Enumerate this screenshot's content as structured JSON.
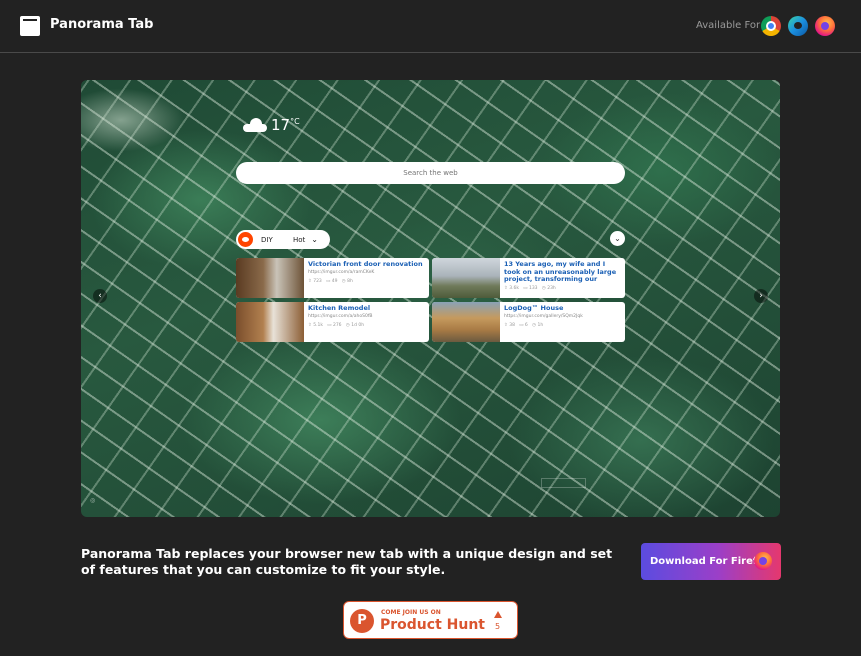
{
  "header": {
    "brand": "Panorama Tab",
    "available_label": "Available For",
    "browser_icons": [
      "chrome-icon",
      "edge-icon",
      "firefox-icon"
    ]
  },
  "preview": {
    "weather": {
      "temperature": "17",
      "unit": "°C",
      "icon": "cloud-icon"
    },
    "search_placeholder": "Search the web",
    "reddit": {
      "subreddit": "DIY",
      "sort": "Hot"
    },
    "posts": [
      {
        "title": "Victorian front door renovation",
        "link": "https://imgur.com/a/ramCKeK",
        "upvotes": "723",
        "comments": "49",
        "age": "8h"
      },
      {
        "title": "13 Years ago, my wife and I took on an unreasonably large project, transforming our",
        "link": "",
        "upvotes": "3.6k",
        "comments": "133",
        "age": "23h"
      },
      {
        "title": "Kitchen Remodel",
        "link": "https://imgur.com/a/ahoS0fB",
        "upvotes": "5.1k",
        "comments": "276",
        "age": "1d 0h"
      },
      {
        "title": "LogDog™ House",
        "link": "https://imgur.com/gallery/SQm2Jqk",
        "upvotes": "38",
        "comments": "6",
        "age": "1h"
      }
    ]
  },
  "tagline": "Panorama Tab replaces your browser new tab with a unique design and set of features that you can customize to fit your style.",
  "download_button": "Download For Firefox",
  "product_hunt": {
    "small": "COME JOIN US ON",
    "big": "Product Hunt",
    "count": "5",
    "logo_letter": "P"
  },
  "colors": {
    "background": "#222222",
    "accent_orange": "#da552f",
    "reddit": "#ff4500"
  }
}
